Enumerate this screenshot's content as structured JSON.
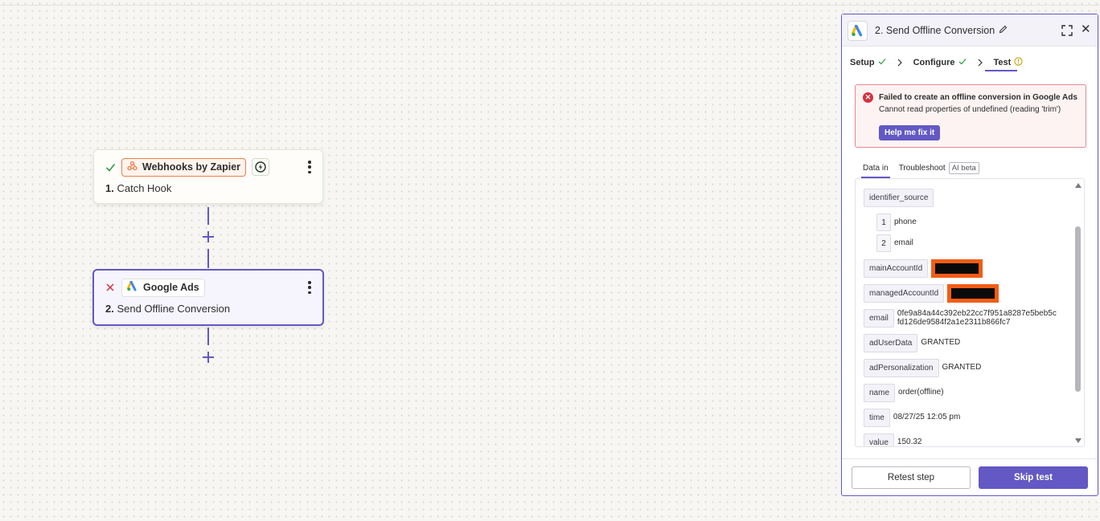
{
  "canvas": {
    "step1": {
      "status": "success",
      "app_label": "Webhooks by Zapier",
      "number": "1.",
      "title": "Catch Hook",
      "icons": [
        "check-icon",
        "webhook-icon",
        "bolt-icon",
        "more-vertical-icon"
      ]
    },
    "step2": {
      "status": "error",
      "app_label": "Google Ads",
      "number": "2.",
      "title": "Send Offline Conversion",
      "icons": [
        "x-icon",
        "google-ads-icon",
        "more-vertical-icon"
      ]
    },
    "colors": {
      "accent": "#6358c4",
      "success": "#2f9e44",
      "error": "#d5303e",
      "webhook": "#f07d4a"
    }
  },
  "panel": {
    "title": "2. Send Offline Conversion",
    "tabs": [
      {
        "label": "Setup",
        "state": "complete"
      },
      {
        "label": "Configure",
        "state": "complete"
      },
      {
        "label": "Test",
        "state": "warning"
      }
    ],
    "error": {
      "title": "Failed to create an offline conversion in Google Ads",
      "message": "Cannot read properties of undefined (reading 'trim')",
      "button": "Help me fix it"
    },
    "data_tabs": {
      "data_in": "Data in",
      "troubleshoot": "Troubleshoot",
      "ai_badge": "AI beta"
    },
    "fields": {
      "identifier_source": {
        "key": "identifier_source",
        "items": [
          {
            "index": "1",
            "value": "phone"
          },
          {
            "index": "2",
            "value": "email"
          }
        ]
      },
      "mainAccountId": {
        "key": "mainAccountId",
        "redacted": true
      },
      "managedAccountId": {
        "key": "managedAccountId",
        "redacted": true
      },
      "email": {
        "key": "email",
        "value": "0fe9a84a44c392eb22cc7f951a8287e5beb5cfd126de9584f2a1e2311b866fc7",
        "line1": "0fe9a84a44c392eb22cc7f951a8287e5beb5c",
        "line2": "fd126de9584f2a1e2311b866fc7"
      },
      "adUserData": {
        "key": "adUserData",
        "value": "GRANTED"
      },
      "adPersonalization": {
        "key": "adPersonalization",
        "value": "GRANTED"
      },
      "name": {
        "key": "name",
        "value": "order(offline)"
      },
      "time": {
        "key": "time",
        "value": "08/27/25 12:05 pm"
      },
      "value": {
        "key": "value",
        "value": "150.32"
      }
    },
    "buttons": {
      "retest": "Retest step",
      "skip": "Skip test"
    }
  }
}
